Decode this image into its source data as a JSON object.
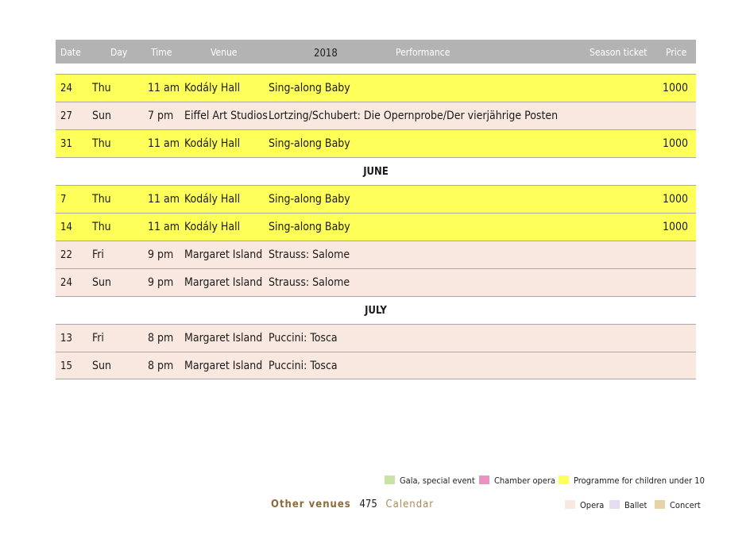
{
  "header": {
    "date": "Date",
    "day": "Day",
    "time": "Time",
    "venue": "Venue",
    "year": "2018",
    "performance": "Performance",
    "season_ticket": "Season ticket",
    "price": "Price"
  },
  "rows": [
    {
      "date": "24",
      "day": "Thu",
      "time": "11 am",
      "venue": "Kodály Hall",
      "performance": "Sing-along Baby",
      "price": "1000"
    },
    {
      "date": "27",
      "day": "Sun",
      "time": "7 pm",
      "venue": "Eiffel Art Studios",
      "performance": "Lortzing/Schubert: Die Opernprobe/Der vierjährige Posten",
      "price": ""
    },
    {
      "date": "31",
      "day": "Thu",
      "time": "11 am",
      "venue": "Kodály Hall",
      "performance": "Sing-along Baby",
      "price": "1000"
    },
    {
      "month": "JUNE"
    },
    {
      "date": "7",
      "day": "Thu",
      "time": "11 am",
      "venue": "Kodály Hall",
      "performance": "Sing-along Baby",
      "price": "1000"
    },
    {
      "date": "14",
      "day": "Thu",
      "time": "11 am",
      "venue": "Kodály Hall",
      "performance": "Sing-along Baby",
      "price": "1000"
    },
    {
      "date": "22",
      "day": "Fri",
      "time": "9 pm",
      "venue": "Margaret Island",
      "performance": "Strauss: Salome",
      "price": ""
    },
    {
      "date": "24",
      "day": "Sun",
      "time": "9 pm",
      "venue": "Margaret Island",
      "performance": "Strauss: Salome",
      "price": ""
    },
    {
      "month": "JULY"
    },
    {
      "date": "13",
      "day": "Fri",
      "time": "8 pm",
      "venue": "Margaret Island",
      "performance": "Puccini: Tosca",
      "price": ""
    },
    {
      "date": "15",
      "day": "Sun",
      "time": "8 pm",
      "venue": "Margaret Island",
      "performance": "Puccini: Tosca",
      "price": ""
    }
  ],
  "legend": {
    "gala": {
      "label": "Gala, special event",
      "color": "#c9e3a4"
    },
    "chamber": {
      "label": "Chamber opera",
      "color": "#ea93c3"
    },
    "children": {
      "label": "Programme for children under 10",
      "color": "#ffff59"
    },
    "opera": {
      "label": "Opera",
      "color": "#f9e8df"
    },
    "ballet": {
      "label": "Ballet",
      "color": "#e6dcf0"
    },
    "concert": {
      "label": "Concert",
      "color": "#e9d3a6"
    }
  },
  "footer": {
    "section": "Other venues",
    "page": "475",
    "chapter": "Calendar",
    "section_color": "#8a6a3e",
    "chapter_color": "#a88a5c"
  }
}
